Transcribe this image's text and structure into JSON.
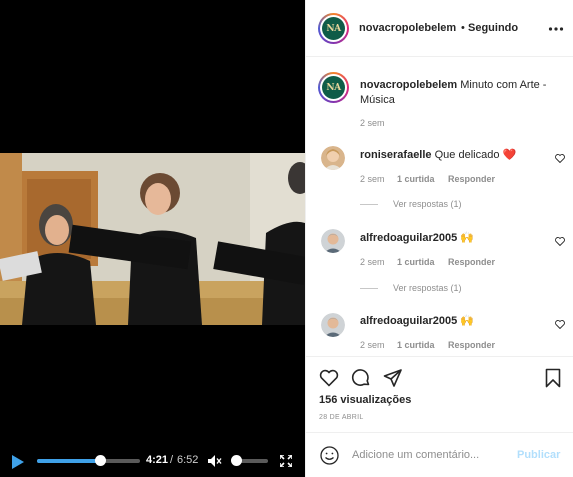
{
  "video": {
    "current_time": "4:21",
    "separator": "/",
    "total_time": "6:52",
    "progress": 0.61,
    "volume": 0.0,
    "accent": "#3fa1e8"
  },
  "icons": {
    "play": "play-icon",
    "mute": "volume-muted-icon",
    "fullscreen": "fullscreen-icon",
    "more": "more-options-icon",
    "like": "heart-icon",
    "comment": "comment-icon",
    "share": "share-icon",
    "save": "bookmark-icon",
    "emoji": "emoji-icon"
  },
  "header": {
    "username": "novacropolebelem",
    "dot": "•",
    "follow_status": "Seguindo"
  },
  "caption": {
    "username": "novacropolebelem",
    "text": "Minuto com Arte - Música",
    "time": "2 sem"
  },
  "comments": [
    {
      "username": "roniserafaelle",
      "text": "Que delicado ❤️",
      "time": "2 sem",
      "likes": "1 curtida",
      "reply": "Responder",
      "view_replies": "Ver respostas (1)"
    },
    {
      "username": "alfredoaguilar2005",
      "text": "🙌",
      "time": "2 sem",
      "likes": "1 curtida",
      "reply": "Responder",
      "view_replies": "Ver respostas (1)"
    },
    {
      "username": "alfredoaguilar2005",
      "text": "🙌",
      "time": "2 sem",
      "likes": "1 curtida",
      "reply": "Responder"
    }
  ],
  "stats": {
    "views": "156 visualizações",
    "date": "28 DE ABRIL"
  },
  "composer": {
    "placeholder": "Adicione um comentário...",
    "publish": "Publicar",
    "publish_color": "#b2dffc"
  },
  "logo_text": "NA"
}
